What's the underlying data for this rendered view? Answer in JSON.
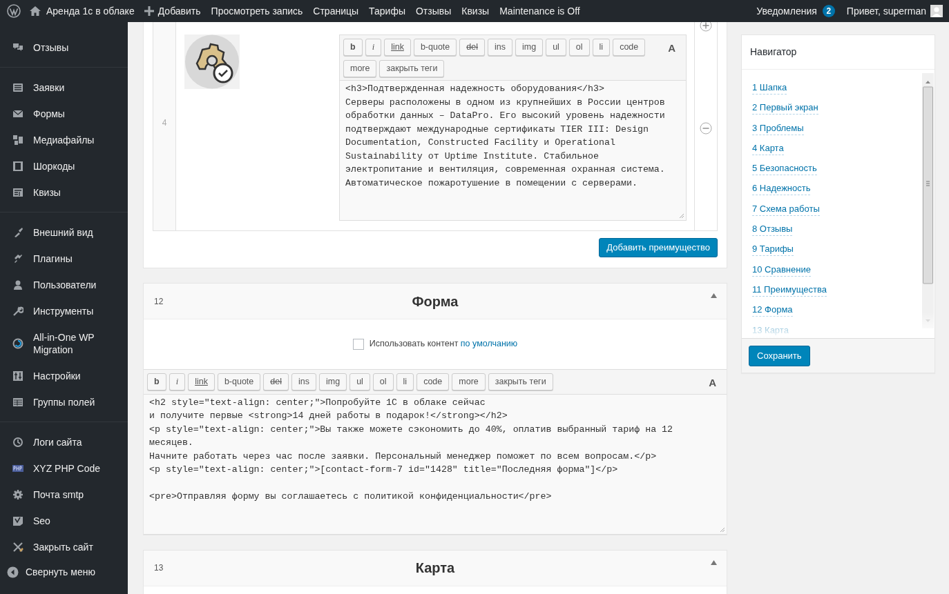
{
  "admin_bar": {
    "site": "Аренда 1с в облаке",
    "new": "Добавить",
    "items": [
      "Просмотреть запись",
      "Страницы",
      "Тарифы",
      "Отзывы",
      "Квизы",
      "Maintenance is Off"
    ],
    "notifications": {
      "label": "Уведомления",
      "count": "2"
    },
    "greeting": "Привет, superman"
  },
  "sidebar": {
    "groups": [
      [
        "Отзывы"
      ],
      [
        "Заявки",
        "Формы",
        "Медиафайлы",
        "Шоркоды",
        "Квизы"
      ],
      [
        "Внешний вид",
        "Плагины",
        "Пользователи",
        "Инструменты",
        "All-in-One WP Migration",
        "Настройки",
        "Группы полей"
      ],
      [
        "Логи сайта",
        "XYZ PHP Code",
        "Почта smtp",
        "Seo",
        "Закрыть сайт"
      ]
    ],
    "collapse": "Свернуть меню"
  },
  "repeater": {
    "row_index": "4",
    "editor": {
      "toolbar": [
        {
          "label": "b",
          "kind": "bold"
        },
        {
          "label": "i",
          "kind": "italic"
        },
        {
          "label": "link",
          "kind": "underline"
        },
        {
          "label": "b-quote",
          "kind": "plain"
        },
        {
          "label": "del",
          "kind": "strike"
        },
        {
          "label": "ins",
          "kind": "plain"
        },
        {
          "label": "img",
          "kind": "plain"
        },
        {
          "label": "ul",
          "kind": "plain"
        },
        {
          "label": "ol",
          "kind": "plain"
        },
        {
          "label": "li",
          "kind": "plain"
        },
        {
          "label": "code",
          "kind": "plain"
        },
        {
          "label": "more",
          "kind": "plain"
        },
        {
          "label": "закрыть теги",
          "kind": "plain"
        }
      ],
      "font_button": "A",
      "content": "<h3>Подтвержденная надежность оборудования</h3>\nСерверы расположены в одном из крупнейших в России центров обработки данных – DataPro. Его высокий уровень надежности подтверждают международные сертификаты TIER III: Design Documentation, Constructed Facility и Operational Sustainability от Uptime Institute. Стабильное электропитание и вентиляция, современная охранная система. Автоматическое пожаротушение в помещении с серверами."
    },
    "add_button": "Добавить преимущество"
  },
  "sections": [
    {
      "number": "12",
      "title": "Форма",
      "checkbox": {
        "label": "Использовать контент",
        "link": "по умолчанию",
        "checked": false
      },
      "editor": {
        "toolbar": [
          {
            "label": "b",
            "kind": "bold"
          },
          {
            "label": "i",
            "kind": "italic"
          },
          {
            "label": "link",
            "kind": "underline"
          },
          {
            "label": "b-quote",
            "kind": "plain"
          },
          {
            "label": "del",
            "kind": "strike"
          },
          {
            "label": "ins",
            "kind": "plain"
          },
          {
            "label": "img",
            "kind": "plain"
          },
          {
            "label": "ul",
            "kind": "plain"
          },
          {
            "label": "ol",
            "kind": "plain"
          },
          {
            "label": "li",
            "kind": "plain"
          },
          {
            "label": "code",
            "kind": "plain"
          },
          {
            "label": "more",
            "kind": "plain"
          },
          {
            "label": "закрыть теги",
            "kind": "plain"
          }
        ],
        "font_button": "A",
        "content": "<h2 style=\"text-align: center;\">Попробуйте 1С в облаке сейчас\nи получите первые <strong>14 дней работы в подарок!</strong></h2>\n<p style=\"text-align: center;\">Вы также можете сэкономить до 40%, оплатив выбранный тариф на 12 месяцев.\nНачните работать через час после заявки. Персональный менеджер поможет по всем вопросам.</p>\n<p style=\"text-align: center;\">[contact-form-7 id=\"1428\" title=\"Последняя форма\"]</p>\n\n<pre>Отправляя форму вы соглашаетесь с политикой конфиденциальности</pre>"
      }
    },
    {
      "number": "13",
      "title": "Карта"
    }
  ],
  "navigator": {
    "title": "Навигатор",
    "items": [
      "1 Шапка",
      "2 Первый экран",
      "3 Проблемы",
      "4 Карта",
      "5 Безопасность",
      "6 Надежность",
      "7 Схема работы",
      "8 Отзывы",
      "9 Тарифы",
      "10 Сравнение",
      "11 Преимущества",
      "12 Форма",
      "13 Карта"
    ],
    "save": "Сохранить"
  }
}
